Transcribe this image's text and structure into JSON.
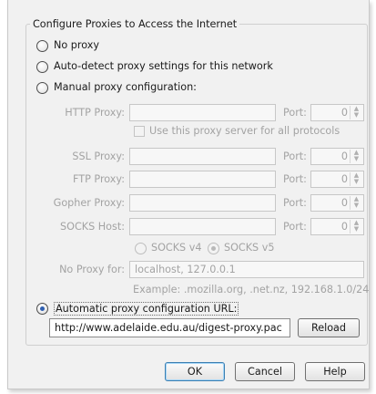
{
  "group": {
    "legend": "Configure Proxies to Access the Internet"
  },
  "options": {
    "no_proxy": "No proxy",
    "auto_detect": "Auto-detect proxy settings for this network",
    "manual": "Manual proxy configuration:",
    "automatic_url": "Automatic proxy configuration URL:"
  },
  "manual": {
    "http_label": "HTTP Proxy:",
    "ssl_label": "SSL Proxy:",
    "ftp_label": "FTP Proxy:",
    "gopher_label": "Gopher Proxy:",
    "socks_label": "SOCKS Host:",
    "port_label": "Port:",
    "http_port": "0",
    "ssl_port": "0",
    "ftp_port": "0",
    "gopher_port": "0",
    "socks_port": "0",
    "same_proxy_label": "Use this proxy server for all protocols",
    "socks_v4": "SOCKS v4",
    "socks_v5": "SOCKS v5",
    "no_proxy_for_label": "No Proxy for:",
    "no_proxy_for_value": "localhost, 127.0.0.1",
    "example": "Example: .mozilla.org, .net.nz, 192.168.1.0/24"
  },
  "auto": {
    "url_value": "http://www.adelaide.edu.au/digest-proxy.pac",
    "reload_label": "Reload"
  },
  "buttons": {
    "ok": "OK",
    "cancel": "Cancel",
    "help": "Help"
  },
  "selected_option": "automatic_url",
  "socks_version_selected": "SOCKS v5",
  "use_same_proxy": false
}
